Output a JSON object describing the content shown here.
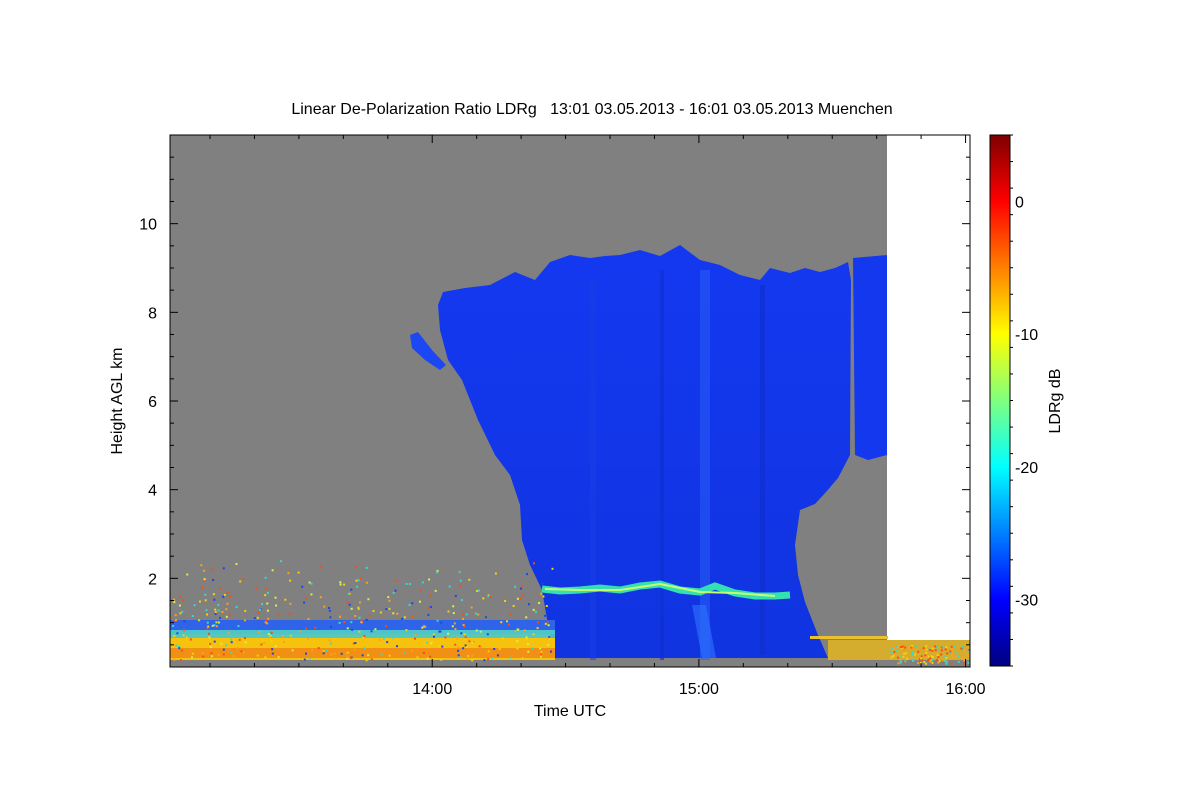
{
  "chart_data": {
    "type": "heatmap",
    "title": "Linear De-Polarization Ratio LDRg   13:01 03.05.2013 - 16:01 03.05.2013 Muenchen",
    "xlabel": "Time UTC",
    "ylabel": "Height AGL km",
    "xlim": [
      "13:01",
      "16:01"
    ],
    "ylim": [
      0,
      12
    ],
    "x_ticks": [
      "14:00",
      "15:00",
      "16:00"
    ],
    "y_ticks": [
      2,
      4,
      6,
      8,
      10
    ],
    "colorbar": {
      "label": "LDRg dB",
      "range": [
        -35,
        5
      ],
      "ticks": [
        0,
        -10,
        -20,
        -30
      ],
      "colormap": "jet"
    },
    "background_color": "#808080",
    "no_data_color": "#ffffff",
    "features": [
      {
        "name": "cloud",
        "ldr_db": -32,
        "start": "14:07",
        "end": "15:40",
        "top_km": 9.3,
        "base_km": 0.0
      },
      {
        "name": "melting-layer",
        "ldr_db": -20,
        "start": "14:25",
        "end": "15:22",
        "height_km": 1.75
      },
      {
        "name": "boundary-layer-clutter",
        "ldr_db": -8,
        "start": "13:01",
        "end": "14:26",
        "top_km": 1.0
      },
      {
        "name": "data-gap",
        "start": "15:42",
        "end": "16:01",
        "above_km": 0.6
      }
    ]
  }
}
